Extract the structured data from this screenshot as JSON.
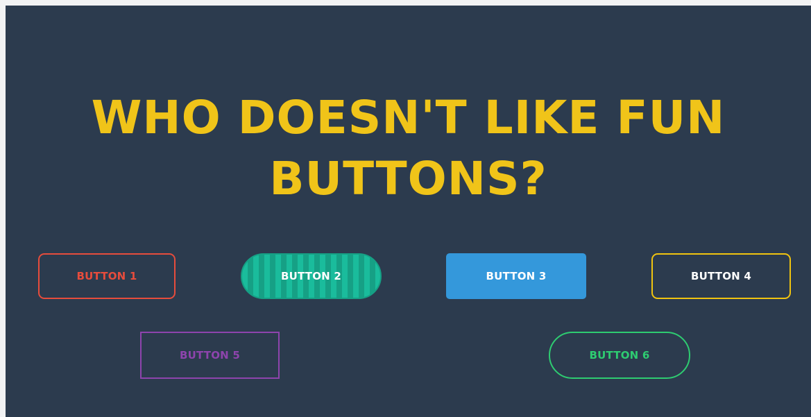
{
  "page": {
    "background_color": "#2c3b4e",
    "accent_color": "#f0c419"
  },
  "headline": {
    "line1": "WHO DOESN'T LIKE FUN",
    "line2": "BUTTONS?"
  },
  "buttons": [
    {
      "label": "BUTTON 1",
      "color": "#e74c3c",
      "style": "outline-rounded"
    },
    {
      "label": "BUTTON 2",
      "color": "#1abc9c",
      "style": "striped-pill"
    },
    {
      "label": "BUTTON 3",
      "color": "#3498db",
      "style": "solid"
    },
    {
      "label": "BUTTON 4",
      "color": "#f1c40f",
      "style": "outline-rounded"
    },
    {
      "label": "BUTTON 5",
      "color": "#8e44ad",
      "style": "outline-square"
    },
    {
      "label": "BUTTON 6",
      "color": "#2ecc71",
      "style": "outline-pill"
    }
  ]
}
